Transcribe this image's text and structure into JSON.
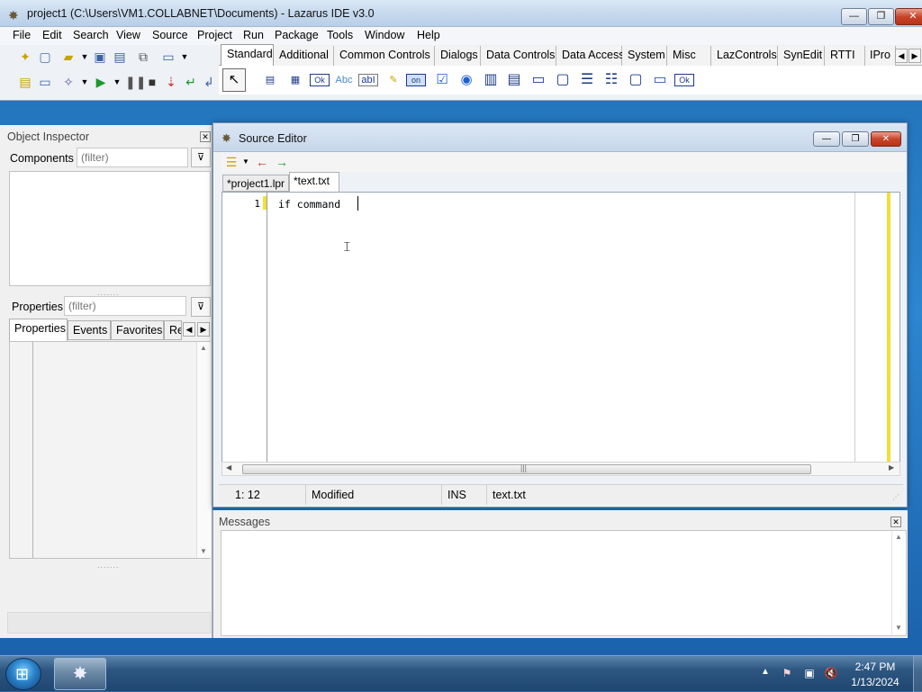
{
  "main_window": {
    "title": "project1 (C:\\Users\\VM1.COLLABNET\\Documents) - Lazarus IDE v3.0",
    "controls": {
      "minimize": "—",
      "maximize": "❐",
      "close": "✕"
    }
  },
  "menu": [
    "File",
    "Edit",
    "Search",
    "View",
    "Source",
    "Project",
    "Run",
    "Package",
    "Tools",
    "Window",
    "Help"
  ],
  "palette": {
    "tabs": [
      "Standard",
      "Additional",
      "Common Controls",
      "Dialogs",
      "Data Controls",
      "Data Access",
      "System",
      "Misc",
      "LazControls",
      "SynEdit",
      "RTTI",
      "IPro"
    ],
    "active_tab": "Standard",
    "component_glyphs": [
      "▤",
      "▦",
      "Ok",
      "Abc",
      "abI",
      "✎",
      "on",
      "☑",
      "◉",
      "▥",
      "▤",
      "▭",
      "▢",
      "☰",
      "☷",
      "▢",
      "▭",
      "Ok"
    ]
  },
  "object_inspector": {
    "title": "Object Inspector",
    "components_label": "Components",
    "components_filter_placeholder": "(filter)",
    "properties_label": "Properties",
    "properties_filter_placeholder": "(filter)",
    "tabs": [
      "Properties",
      "Events",
      "Favorites",
      "Re"
    ],
    "splitter": "......."
  },
  "source_editor": {
    "title": "Source Editor",
    "tabs": [
      "*project1.lpr",
      "*text.txt"
    ],
    "active_tab": "*text.txt",
    "line_number": "1",
    "code": "if command ",
    "scroll_grip": "|||",
    "status": {
      "position": "1: 12",
      "state": "Modified",
      "mode": "INS",
      "file": "text.txt"
    }
  },
  "messages": {
    "title": "Messages"
  },
  "taskbar": {
    "start_glyph": "⊞",
    "lazarus_glyph": "✸",
    "clock_time": "2:47 PM",
    "clock_date": "1/13/2024"
  },
  "colors": {
    "accent_yellow": "#f2df38",
    "desktop_blue": "#1f6db3",
    "title_bar": "#c7d9ee"
  }
}
